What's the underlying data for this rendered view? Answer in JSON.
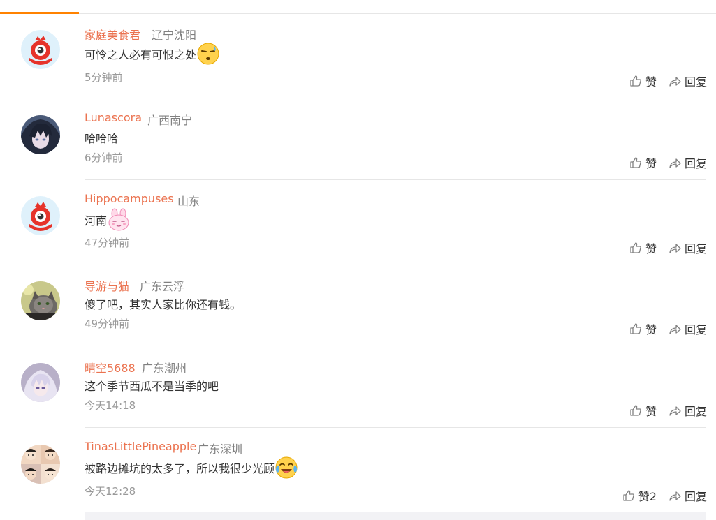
{
  "comments": [
    {
      "user": "家庭美食君",
      "location": "辽宁沈阳",
      "text": "可怜之人必有可恨之处",
      "emoji": "sweat-face-emoji",
      "time": "5分钟前",
      "like_label": "赞",
      "reply_label": "回复",
      "avatar": "weibo-default-avatar"
    },
    {
      "user": "Lunascora",
      "location": "广西南宁",
      "text": "哈哈哈",
      "time": "6分钟前",
      "like_label": "赞",
      "reply_label": "回复",
      "avatar": "anime-boy-avatar"
    },
    {
      "user": "Hippocampuses",
      "location": "山东",
      "text": "河南",
      "emoji": "bunny-face-emoji",
      "time": "47分钟前",
      "like_label": "赞",
      "reply_label": "回复",
      "avatar": "weibo-default-avatar"
    },
    {
      "user": "导游与猫",
      "location": "广东云浮",
      "text": "傻了吧，其实人家比你还有钱。",
      "time": "49分钟前",
      "like_label": "赞",
      "reply_label": "回复",
      "avatar": "cat-photo-avatar"
    },
    {
      "user": "晴空5688",
      "location": "广东潮州",
      "text": "这个季节西瓜不是当季的吧",
      "time": "今天14:18",
      "like_label": "赞",
      "reply_label": "回复",
      "avatar": "anime-girl-avatar"
    },
    {
      "user": "TinasLittlePineapple",
      "location": "广东深圳",
      "text": "被路边摊坑的太多了，所以我很少光顾",
      "emoji": "crying-laughing-emoji",
      "time": "今天12:28",
      "like_label": "赞2",
      "reply_label": "回复",
      "avatar": "kids-collage-avatar"
    }
  ],
  "colors": {
    "accent": "#ff8200",
    "username": "#eb7350",
    "location": "#808080",
    "time": "#999999",
    "text": "#333333"
  }
}
